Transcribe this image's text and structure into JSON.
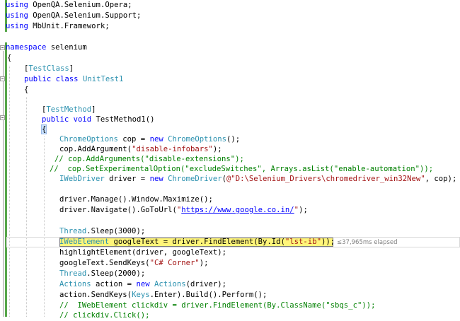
{
  "editor": {
    "lines": {
      "l1": {
        "kw": "using",
        "rest": " OpenQA.Selenium.Opera;"
      },
      "l2": {
        "kw": "using",
        "rest": " OpenQA.Selenium.Support;"
      },
      "l3": {
        "kw": "using",
        "rest": " MbUnit.Framework;"
      },
      "l5": {
        "kw": "namespace",
        "rest": " selenium"
      },
      "l6": "{",
      "l7": {
        "open": "[",
        "attr": "TestClass",
        "close": "]"
      },
      "l8": {
        "kw": "public class",
        "type": "UnitTest1"
      },
      "l9": "{",
      "l11": {
        "open": "[",
        "attr": "TestMethod",
        "close": "]"
      },
      "l12": {
        "kw": "public void",
        "rest": " TestMethod1()"
      },
      "l13": "{",
      "l14": {
        "type1": "ChromeOptions",
        "a": " cop = ",
        "kw": "new",
        "sp": " ",
        "type2": "ChromeOptions",
        "b": "();"
      },
      "l15": {
        "a": "cop.AddArgument(",
        "s": "\"disable-infobars\"",
        "b": ");"
      },
      "l16": "// cop.AddArguments(\"disable-extensions\");",
      "l17": "//  cop.SetExperimentalOption(\"excludeSwitches\", Arrays.asList(\"enable-automation\"));",
      "l18": {
        "type1": "IWebDriver",
        "a": " driver = ",
        "kw": "new",
        "sp": " ",
        "type2": "ChromeDriver",
        "b": "(",
        "s": "@\"D:\\Selenium_Drivers\\chromedriver_win32New\"",
        "c": ", cop);"
      },
      "l20": "driver.Manage().Window.Maximize();",
      "l21": {
        "a": "driver.Navigate().GoToUrl(",
        "q1": "\"",
        "url": "https://www.google.co.in/",
        "q2": "\"",
        "b": ");"
      },
      "l23": {
        "type": "Thread",
        "a": ".Sleep(3000);"
      },
      "l24": {
        "type": "IWebElement",
        "a": " googleText = driver.FindElement(By.Id(",
        "s": "\"lst-ib\"",
        "b": "));"
      },
      "l25": "highlightElement(driver, googleText);",
      "l26": {
        "a": "googleText.SendKeys(",
        "s": "\"C# Corner\"",
        "b": ");"
      },
      "l27": {
        "type": "Thread",
        "a": ".Sleep(2000);"
      },
      "l28": {
        "type": "Actions",
        "a": " action = ",
        "kw": "new",
        "sp": " ",
        "type2": "Actions",
        "b": "(driver);"
      },
      "l29": {
        "a": "action.SendKeys(",
        "type": "Keys",
        "b": ".Enter).Build().Perform();"
      },
      "l30": "//  IWebElement clickdiv = driver.FindElement(By.ClassName(\"sbqs_c\"));",
      "l31": "// clickdiv.Click();"
    },
    "perf_tip": "≤37,965ms elapsed"
  }
}
